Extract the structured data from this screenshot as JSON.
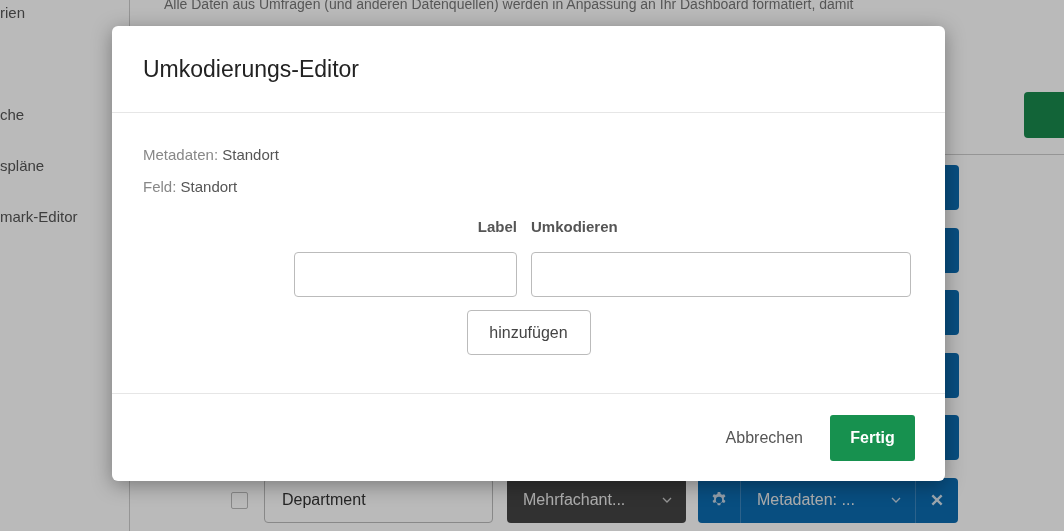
{
  "sidebar": {
    "items": [
      {
        "label": "rien"
      },
      {
        "label": "che"
      },
      {
        "label": "spläne"
      },
      {
        "label": "mark-Editor"
      }
    ]
  },
  "intro_text": "Alle Daten aus Umfragen (und anderen Datenquellen) werden in Anpassung an Ihr Dashboard formatiert, damit",
  "rows": [
    {
      "kind": "covered"
    },
    {
      "kind": "covered"
    },
    {
      "kind": "covered"
    },
    {
      "kind": "covered"
    },
    {
      "kind": "covered"
    },
    {
      "kind": "field",
      "checked": false,
      "name": "Department",
      "type": "Mehrfachant...",
      "source": "Metadaten: ..."
    }
  ],
  "dialog": {
    "title": "Umkodierungs-Editor",
    "info": [
      {
        "label": "Metadaten:",
        "value": "Standort"
      },
      {
        "label": "Feld:",
        "value": "Standort"
      }
    ],
    "columns": [
      "Label",
      "Umkodieren"
    ],
    "add_button": "hinzufügen",
    "buttons": [
      {
        "label": "Abbrechen",
        "kind": "secondary"
      },
      {
        "label": "Fertig",
        "kind": "primary"
      }
    ]
  }
}
